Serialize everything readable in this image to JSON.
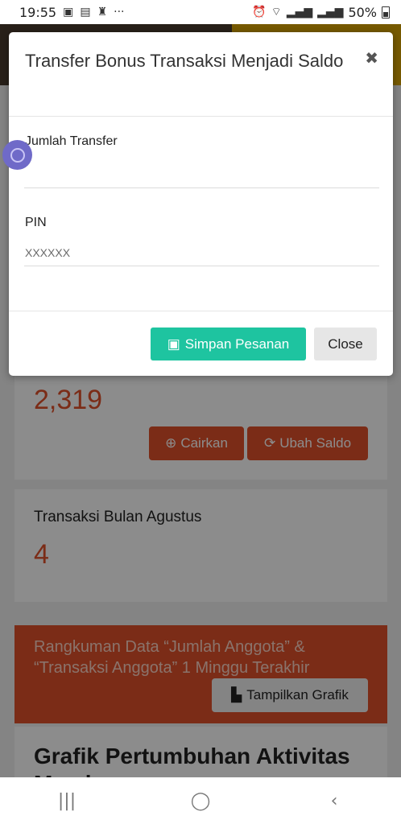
{
  "status_bar": {
    "time": "19:55",
    "more": "···",
    "battery": "50%",
    "icons": [
      "gallery-icon",
      "video-icon",
      "figure-icon",
      "alarm-icon",
      "wifi-icon",
      "signal-icon",
      "signal-icon",
      "battery-icon"
    ]
  },
  "modal": {
    "title": "Transfer Bonus Transaksi Menjadi Saldo",
    "close_symbol": "✖",
    "fields": {
      "jumlah_label": "Jumlah Transfer",
      "jumlah_value": "",
      "pin_label": "PIN",
      "pin_placeholder": "XXXXXX"
    },
    "save_label": "Simpan Pesanan",
    "close_label": "Close"
  },
  "background": {
    "saldo_value": "2,319",
    "cairkan_label": "Cairkan",
    "ubah_saldo_label": "Ubah Saldo",
    "transaksi_title": "Transaksi Bulan Agustus",
    "transaksi_value": "4",
    "rangkuman_text": "Rangkuman Data “Jumlah Anggota” & “Transaksi Anggota” 1 Minggu Terakhir",
    "tampilkan_label": "Tampilkan Grafik",
    "grafik_title": "Grafik Pertumbuhan Aktivitas Member"
  },
  "nav": {
    "recent": "|||",
    "home": "◯",
    "back": "‹"
  },
  "colors": {
    "accent_orange": "#e0502a",
    "save_green": "#1ec4a0"
  }
}
